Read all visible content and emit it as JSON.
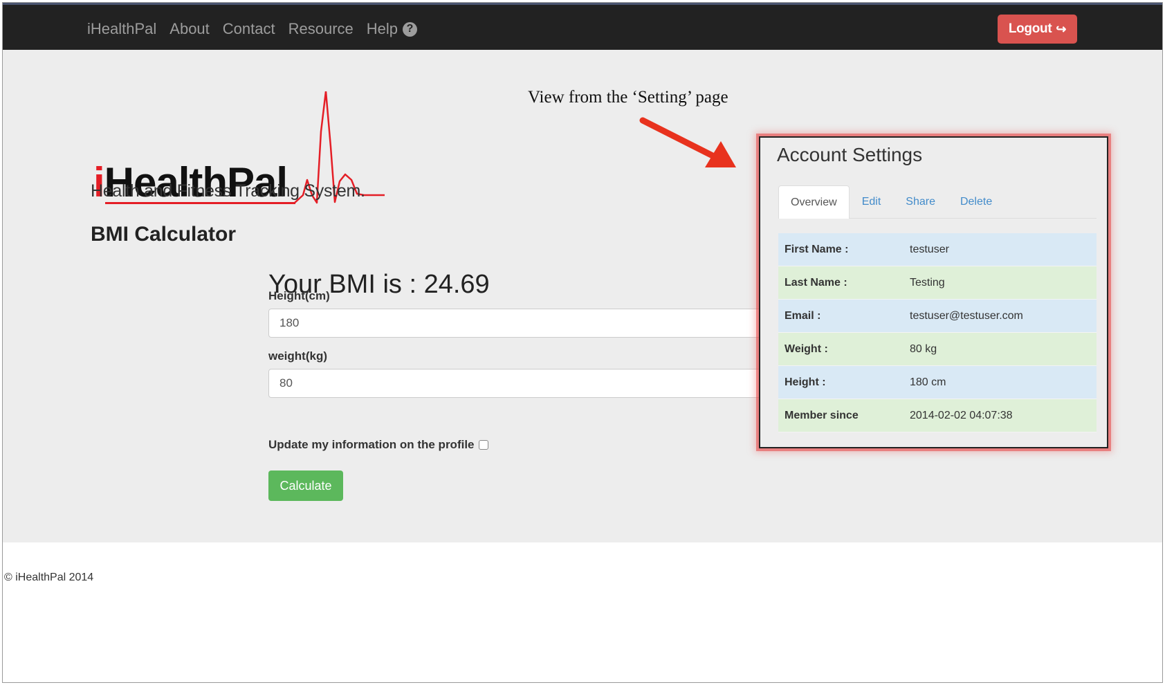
{
  "nav": {
    "brand": "iHealthPal",
    "links": [
      "About",
      "Contact",
      "Resource"
    ],
    "help": "Help",
    "help_icon": "question-circle-icon",
    "logout": "Logout",
    "logout_icon": "sign-out-icon"
  },
  "logo": {
    "i": "i",
    "rest": "HealthPal",
    "tagline": "Health and Fitness Tracking System."
  },
  "page": {
    "heading": "BMI Calculator",
    "bmi_result": "Your BMI is : 24.69",
    "height_label": "Height(cm)",
    "height_value": "180",
    "weight_label": "weight(kg)",
    "weight_value": "80",
    "update_label": "Update my information on the profile",
    "calculate": "Calculate"
  },
  "annotation": "View from the ‘Setting’ page",
  "settings": {
    "title": "Account Settings",
    "tabs": [
      "Overview",
      "Edit",
      "Share",
      "Delete"
    ],
    "rows": [
      {
        "key": "First Name :",
        "value": "testuser"
      },
      {
        "key": "Last Name :",
        "value": "Testing"
      },
      {
        "key": "Email :",
        "value": "testuser@testuser.com"
      },
      {
        "key": "Weight :",
        "value": "80 kg"
      },
      {
        "key": "Height :",
        "value": "180 cm"
      },
      {
        "key": "Member since",
        "value": "2014-02-02 04:07:38"
      }
    ]
  },
  "footer": "© iHealthPal 2014",
  "colors": {
    "navbar": "#222222",
    "logout": "#d9534f",
    "calculate": "#5cb85c",
    "brand_red": "#e41e26",
    "link": "#428bca"
  }
}
